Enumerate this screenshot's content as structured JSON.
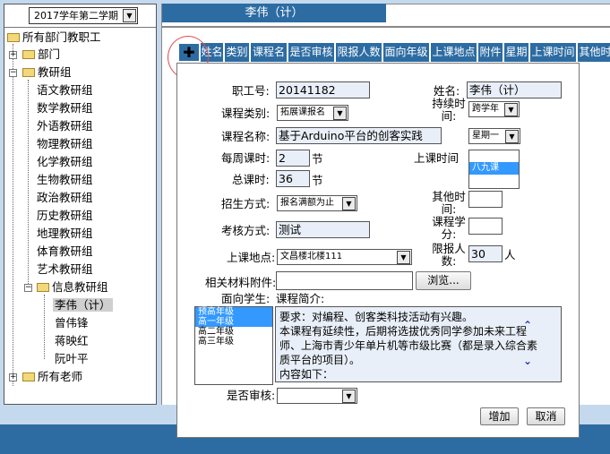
{
  "sidebar": {
    "semester": "2017学年第二学期",
    "tree": {
      "root": "所有部门教职工",
      "dept": "部门",
      "research": "教研组",
      "groups": [
        "语文教研组",
        "数学教研组",
        "外语教研组",
        "物理教研组",
        "化学教研组",
        "生物教研组",
        "政治教研组",
        "历史教研组",
        "地理教研组",
        "体育教研组",
        "艺术教研组"
      ],
      "info_group": "信息教研组",
      "members": [
        "李伟（计）",
        "曾伟锋",
        "蒋映红",
        "阮叶平"
      ],
      "all_teachers": "所有老师"
    }
  },
  "header": {
    "title": "李伟（计）",
    "add_symbol": "✚",
    "columns": [
      "姓名",
      "类别",
      "课程名",
      "是否审核",
      "限报人数",
      "面向年级",
      "上课地点",
      "附件",
      "星期",
      "上课时间",
      "其他时"
    ]
  },
  "form": {
    "staff_id_label": "职工号:",
    "staff_id": "20141182",
    "name_label": "姓名:",
    "name": "李伟（计）",
    "course_type_label": "课程类别:",
    "course_type": "拓展课报名",
    "duration_label": "持续时间:",
    "duration": "跨学年",
    "course_name_label": "课程名称:",
    "course_name": "基于Arduino平台的创客实践",
    "weekday": "星期一",
    "weekly_hours_label": "每周课时:",
    "weekly_hours": "2",
    "unit_jie": "节",
    "class_time_label": "上课时间",
    "class_time_options": [
      "",
      "八九课",
      ""
    ],
    "total_hours_label": "总课时:",
    "total_hours": "36",
    "enroll_method_label": "招生方式:",
    "enroll_method": "报名满额为止",
    "other_time_label": "其他时间:",
    "other_time": "",
    "assess_method_label": "考核方式:",
    "assess_method": "测试",
    "credits_label": "课程学分:",
    "credits": "",
    "location_label": "上课地点:",
    "location": "文昌楼北楼111",
    "limit_label": "限报人数:",
    "limit": "30",
    "unit_ren": "人",
    "attachment_label": "相关材料附件:",
    "attachment": "",
    "browse_button": "浏览...",
    "target_label": "面向学生:",
    "grades": [
      "预高年级",
      "高一年级",
      "高二年级",
      "高三年级"
    ],
    "intro_label": "课程简介:",
    "intro_text": "要求：对编程、创客类科技活动有兴趣。\n本课程有延续性，后期将选拔优秀同学参加未来工程师、上海市青少年单片机等市级比赛（都是录入综合素质平台的项目）。\n内容如下：",
    "review_label": "是否审核:",
    "review": "",
    "add_button": "增加",
    "cancel_button": "取消"
  }
}
